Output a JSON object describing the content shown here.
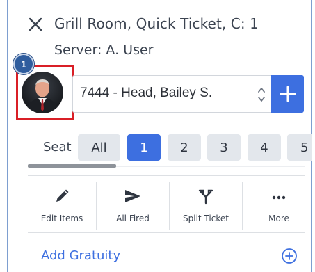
{
  "header": {
    "title": "Grill Room, Quick Ticket, C: 1",
    "server": "Server: A. User"
  },
  "callout": {
    "number": "1",
    "color": "#d91f26"
  },
  "guest": {
    "selected": "7444 - Head, Bailey S.",
    "add_icon": "plus-icon"
  },
  "seats": {
    "label": "Seat",
    "items": [
      "All",
      "1",
      "2",
      "3",
      "4",
      "5"
    ],
    "active": "1"
  },
  "actions": [
    {
      "label": "Edit Items",
      "icon": "pencil-icon"
    },
    {
      "label": "All Fired",
      "icon": "send-icon"
    },
    {
      "label": "Split Ticket",
      "icon": "split-icon"
    },
    {
      "label": "More",
      "icon": "ellipsis-icon"
    }
  ],
  "gratuity": {
    "label": "Add Gratuity",
    "icon": "circle-plus-icon"
  },
  "colors": {
    "accent": "#3d6fe0",
    "frame": "#7e9fd0",
    "seat_bg": "#e3e7ec"
  }
}
